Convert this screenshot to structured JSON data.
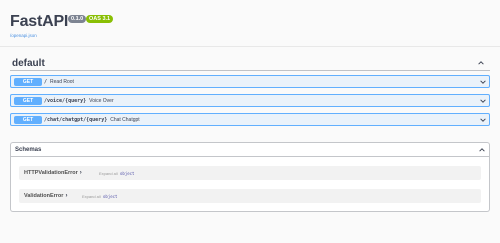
{
  "info": {
    "title": "FastAPI",
    "version_badge": "0.1.0",
    "oas_badge": "OAS 3.1",
    "openapi_link": "/openapi.json"
  },
  "tag": {
    "name": "default"
  },
  "operations": [
    {
      "method": "GET",
      "path": "/",
      "summary": "Read Root"
    },
    {
      "method": "GET",
      "path": "/voice/{query}",
      "summary": "Voice Over"
    },
    {
      "method": "GET",
      "path": "/chat/chatgpt/{query}",
      "summary": "Chat Chatgpt"
    }
  ],
  "schemas": {
    "title": "Schemas",
    "models": [
      {
        "name": "HTTPValidationError",
        "expand_label": "Expand all",
        "type": "object"
      },
      {
        "name": "ValidationError",
        "expand_label": "Expand all",
        "type": "object"
      }
    ]
  },
  "colors": {
    "get_method": "#61affe",
    "version_badge": "#7d8492",
    "oas_badge": "#89bf04",
    "link": "#4990e2"
  }
}
